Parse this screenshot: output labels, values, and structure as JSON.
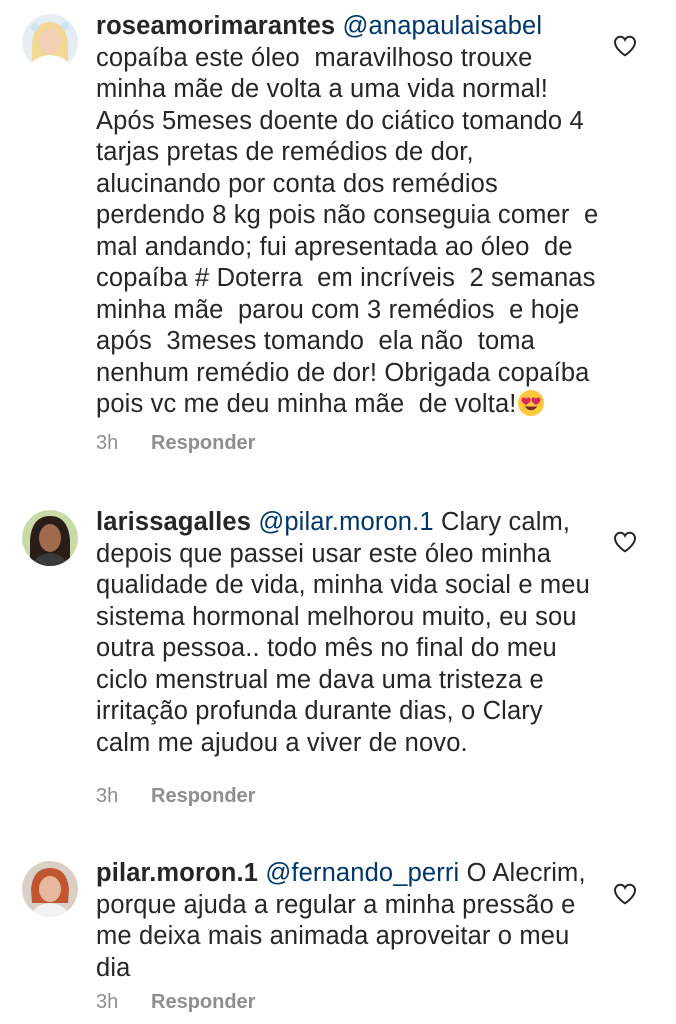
{
  "comments": [
    {
      "username": "roseamorimarantes",
      "mention": "@anapaulaisabel",
      "text": "copaíba este óleo  maravilhoso trouxe minha mãe de volta a uma vida normal! Após 5meses doente do ciático tomando 4 tarjas pretas de remédios de dor, alucinando por conta dos remédios perdendo 8 kg pois não conseguia comer  e mal andando; fui apresentada ao óleo  de copaíba # Doterra  em incríveis  2 semanas minha mãe  parou com 3 remédios  e hoje após  3meses tomando  ela não  toma nenhum remédio de dor! Obrigada copaíba pois vc me deu minha mãe  de volta!",
      "emoji": "smiling-face-with-heart-eyes-icon",
      "time": "3h",
      "reply_label": "Responder"
    },
    {
      "username": "larissagalles",
      "mention": "@pilar.moron.1",
      "text": "Clary calm, depois que passei usar este óleo minha qualidade de vida, minha vida social e meu sistema hormonal melhorou muito, eu sou outra pessoa.. todo mês no final do meu ciclo menstrual me dava uma tristeza e irritação profunda durante dias, o Clary calm me ajudou a viver de novo.",
      "time": "3h",
      "reply_label": "Responder"
    },
    {
      "username": "pilar.moron.1",
      "mention": "@fernando_perri",
      "text": "O Alecrim, porque ajuda a regular a minha pressão e me deixa mais animada aproveitar o meu dia",
      "time": "3h",
      "reply_label": "Responder"
    }
  ],
  "icons": {
    "like": "heart-outline-icon"
  },
  "colors": {
    "text": "#262626",
    "mention": "#00376b",
    "secondary": "#8e8e8e"
  }
}
